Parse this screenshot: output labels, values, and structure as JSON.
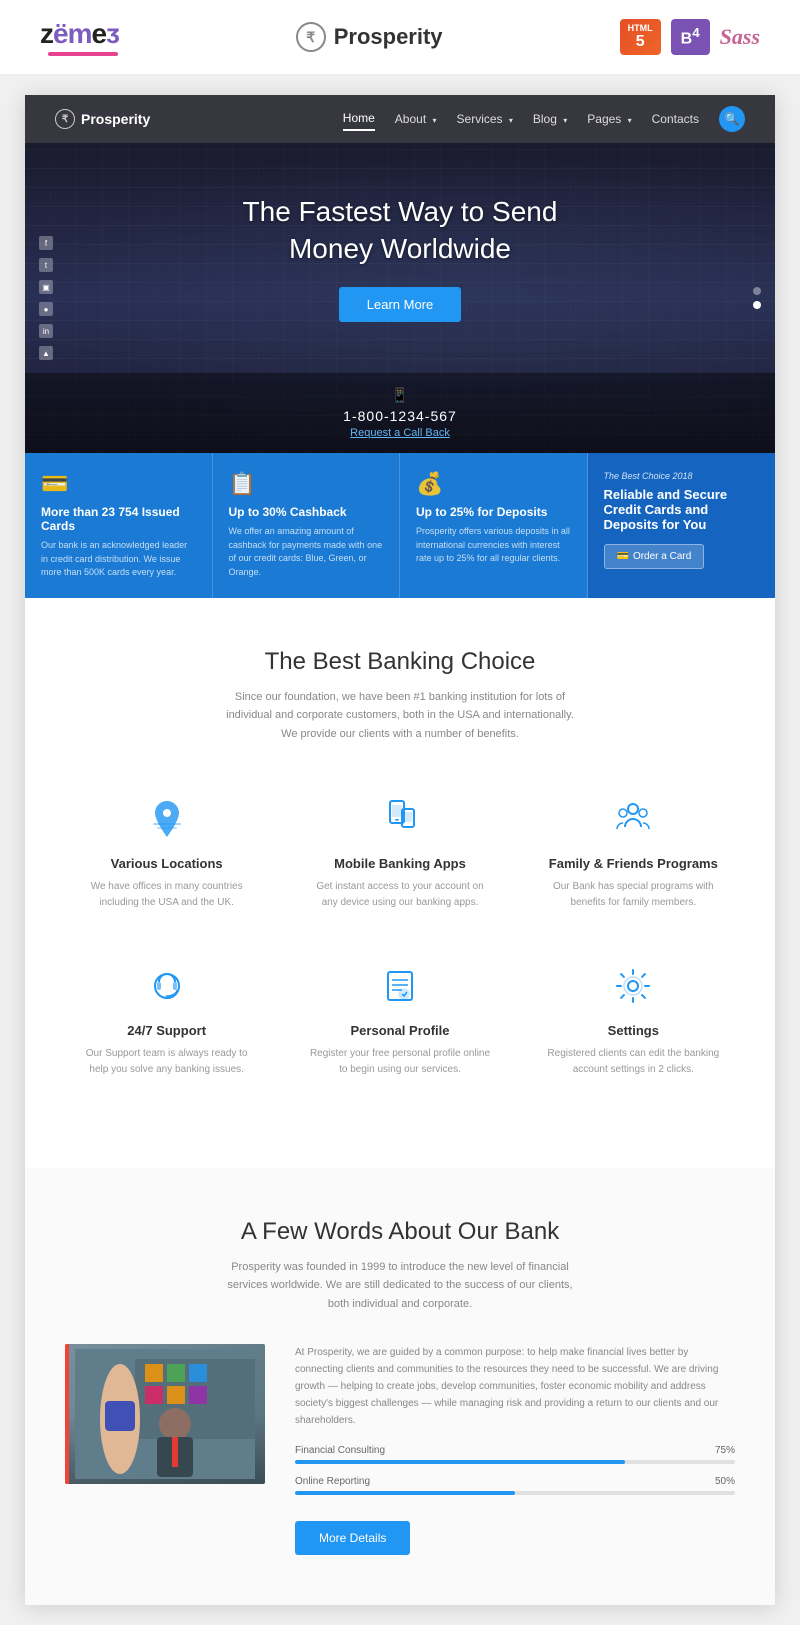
{
  "topbar": {
    "zemes_logo": "Zemes",
    "site_brand": "Prosperity",
    "rupee_symbol": "₹",
    "badges": {
      "html": "HTML5",
      "html_num": "5",
      "bootstrap": "B⁴",
      "sass": "Sass"
    }
  },
  "sitenav": {
    "brand": "Prosperity",
    "links": [
      {
        "label": "Home",
        "active": true,
        "has_arrow": false
      },
      {
        "label": "About",
        "active": false,
        "has_arrow": true
      },
      {
        "label": "Services",
        "active": false,
        "has_arrow": true
      },
      {
        "label": "Blog",
        "active": false,
        "has_arrow": true
      },
      {
        "label": "Pages",
        "active": false,
        "has_arrow": true
      },
      {
        "label": "Contacts",
        "active": false,
        "has_arrow": false
      }
    ],
    "search_label": "🔍"
  },
  "hero": {
    "title_line1": "The Fastest Way to Send",
    "title_line2": "Money Worldwide",
    "cta_button": "Learn More",
    "phone_icon": "📱",
    "phone_number": "1-800-1234-567",
    "callback_link": "Request a Call Back",
    "social_icons": [
      "f",
      "t",
      "in",
      "●",
      "in",
      "▲"
    ]
  },
  "features_bar": [
    {
      "icon": "💳",
      "title_pre": "More than ",
      "title_num": "23 754",
      "title_post": " Issued Cards",
      "desc": "Our bank is an acknowledged leader in credit card distribution. We issue more than 500K cards every year."
    },
    {
      "icon": "📋",
      "title_pre": "Up to ",
      "title_num": "30%",
      "title_post": " Cashback",
      "desc": "We offer an amazing amount of cashback for payments made with one of our credit cards: Blue, Green, or Orange."
    },
    {
      "icon": "💰",
      "title_pre": "Up to ",
      "title_num": "25%",
      "title_post": " for Deposits",
      "desc": "Prosperity offers various deposits in all international currencies with interest rate up to 25% for all regular clients."
    },
    {
      "badge": "The Best Choice 2018",
      "title": "Reliable and Secure Credit Cards and Deposits for You",
      "btn_label": "Order a Card",
      "btn_icon": "💳"
    }
  ],
  "banking_section": {
    "title": "The Best Banking Choice",
    "desc": "Since our foundation, we have been #1 banking institution for lots of individual and corporate customers, both in the USA and internationally. We provide our clients with a number of benefits.",
    "features": [
      {
        "icon": "🗺️",
        "title": "Various Locations",
        "desc": "We have offices in many countries including the USA and the UK."
      },
      {
        "icon": "📱",
        "title": "Mobile Banking Apps",
        "desc": "Get instant access to your account on any device using our banking apps."
      },
      {
        "icon": "👨‍👩‍👧",
        "title": "Family & Friends Programs",
        "desc": "Our Bank has special programs with benefits for family members."
      },
      {
        "icon": "🎧",
        "title": "24/7 Support",
        "desc": "Our Support team is always ready to help you solve any banking issues."
      },
      {
        "icon": "👤",
        "title": "Personal Profile",
        "desc": "Register your free personal profile online to begin using our services."
      },
      {
        "icon": "⚙️",
        "title": "Settings",
        "desc": "Registered clients can edit the banking account settings in 2 clicks."
      }
    ]
  },
  "about_section": {
    "title": "A Few Words About Our Bank",
    "desc": "Prosperity was founded in 1999 to introduce the new level of financial services worldwide. We are still dedicated to the success of our clients, both individual and corporate.",
    "body_text": "At Prosperity, we are guided by a common purpose: to help make financial lives better by connecting clients and communities to the resources they need to be successful. We are driving growth — helping to create jobs, develop communities, foster economic mobility and address society's biggest challenges — while managing risk and providing a return to our clients and our shareholders.",
    "progress_bars": [
      {
        "label": "Financial Consulting",
        "value": 75,
        "display": "75%"
      },
      {
        "label": "Online Reporting",
        "value": 50,
        "display": "50%"
      }
    ],
    "more_details_btn": "More Details"
  },
  "colors": {
    "primary_blue": "#2196f3",
    "dark_blue": "#1565c0",
    "text_dark": "#333333",
    "text_muted": "#888888"
  }
}
